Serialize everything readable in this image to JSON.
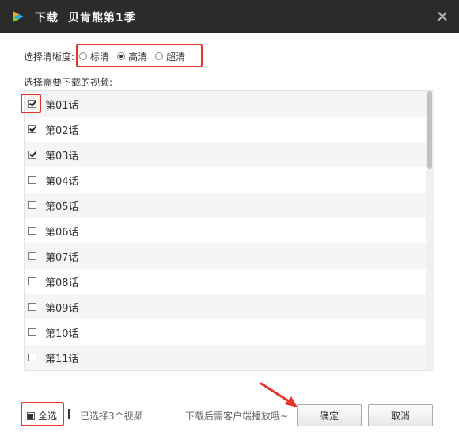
{
  "window": {
    "title_action": "下载",
    "title_name": "贝肯熊第1季",
    "close_glyph": "✕"
  },
  "quality": {
    "label": "选择清晰度:",
    "options": [
      {
        "label": "标清",
        "selected": false
      },
      {
        "label": "高清",
        "selected": true
      },
      {
        "label": "超清",
        "selected": false
      }
    ]
  },
  "episode_list": {
    "title": "选择需要下载的视频:",
    "items": [
      {
        "label": "第01话",
        "checked": true
      },
      {
        "label": "第02话",
        "checked": true
      },
      {
        "label": "第03话",
        "checked": true
      },
      {
        "label": "第04话",
        "checked": false
      },
      {
        "label": "第05话",
        "checked": false
      },
      {
        "label": "第06话",
        "checked": false
      },
      {
        "label": "第07话",
        "checked": false
      },
      {
        "label": "第08话",
        "checked": false
      },
      {
        "label": "第09话",
        "checked": false
      },
      {
        "label": "第10话",
        "checked": false
      },
      {
        "label": "第11话",
        "checked": false
      }
    ]
  },
  "footer": {
    "select_all_label": "全选",
    "selected_count_text": "已选择3个视频",
    "hint_text": "下载后需客户端播放哦~",
    "ok_label": "确定",
    "cancel_label": "取消"
  },
  "colors": {
    "titlebar": "#2b2b2b",
    "highlight": "#e8332b",
    "row_stripe": "#f5f5f5"
  }
}
